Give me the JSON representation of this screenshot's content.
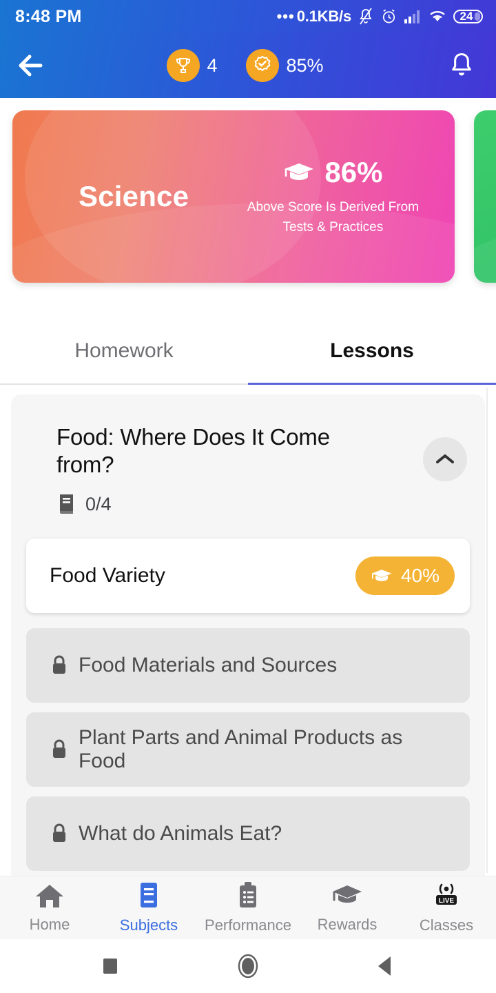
{
  "status_bar": {
    "time": "8:48 PM",
    "network_speed": "0.1KB/s",
    "leading_dots": "•••",
    "battery_level": "24",
    "icons": [
      "bell-muted-icon",
      "alarm-icon",
      "signal-icon",
      "wifi-icon",
      "battery-icon"
    ]
  },
  "app_bar": {
    "back_icon": "arrow-left-icon",
    "trophy_icon": "trophy-icon",
    "trophy_count": "4",
    "badge_icon": "verified-badge-icon",
    "badge_percent": "85%",
    "notification_icon": "bell-icon"
  },
  "carousel": {
    "cards": [
      {
        "title": "Science",
        "score": "86%",
        "score_icon": "graduation-cap-icon",
        "note_line1": "Above Score Is Derived From",
        "note_line2": "Tests & Practices",
        "gradient_from": "#f07a4e",
        "gradient_to": "#ef45b4"
      },
      {
        "title": "",
        "gradient_from": "#3ecd6d",
        "gradient_to": "#27bb63"
      }
    ]
  },
  "tabs": [
    {
      "label": "Homework",
      "active": false
    },
    {
      "label": "Lessons",
      "active": true
    }
  ],
  "lesson_group": {
    "title": "Food: Where Does It Come from?",
    "progress_icon": "book-icon",
    "progress": "0/4",
    "collapse_icon": "chevron-up-icon",
    "lessons": [
      {
        "label": "Food Variety",
        "locked": false,
        "score": "40%",
        "score_icon": "graduation-cap-icon"
      },
      {
        "label": "Food Materials and Sources",
        "locked": true,
        "lock_icon": "lock-icon"
      },
      {
        "label": "Plant Parts and Animal Products as Food",
        "locked": true,
        "lock_icon": "lock-icon"
      },
      {
        "label": "What do Animals Eat?",
        "locked": true,
        "lock_icon": "lock-icon"
      }
    ]
  },
  "bottom_nav": {
    "items": [
      {
        "label": "Home",
        "icon": "home-icon",
        "active": false
      },
      {
        "label": "Subjects",
        "icon": "book-icon",
        "active": true
      },
      {
        "label": "Performance",
        "icon": "clipboard-icon",
        "active": false
      },
      {
        "label": "Rewards",
        "icon": "graduation-cap-icon",
        "active": false
      },
      {
        "label": "Classes",
        "icon": "live-broadcast-icon",
        "active": false
      }
    ],
    "active_color": "#3b6fe0",
    "inactive_color": "#8a8a8e"
  },
  "android_nav": {
    "recents_icon": "square-icon",
    "home_icon": "circle-icon",
    "back_icon": "triangle-left-icon"
  }
}
